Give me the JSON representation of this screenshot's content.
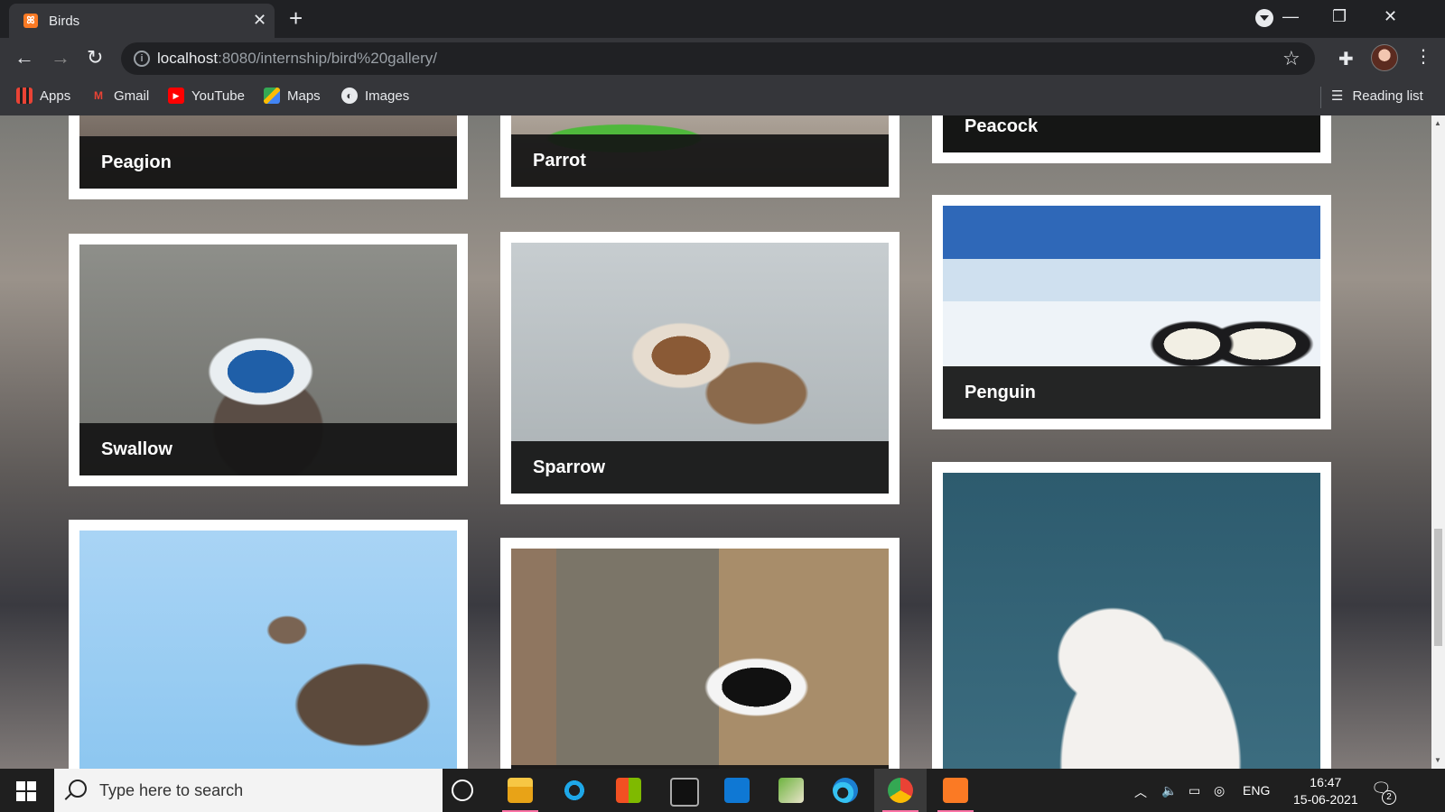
{
  "browser": {
    "tab_title": "Birds",
    "tab_favicon": "xampp-icon",
    "url_host": "localhost",
    "url_rest": ":8080/internship/bird%20gallery/",
    "bookmarks": [
      "Apps",
      "Gmail",
      "YouTube",
      "Maps",
      "Images"
    ],
    "reading_list": "Reading list"
  },
  "gallery": {
    "cards": [
      {
        "label": "Peagion"
      },
      {
        "label": "Parrot"
      },
      {
        "label": "Peacock"
      },
      {
        "label": "Swallow"
      },
      {
        "label": "Sparrow"
      },
      {
        "label": "Penguin"
      },
      {
        "label": ""
      },
      {
        "label": ""
      },
      {
        "label": ""
      }
    ]
  },
  "taskbar": {
    "search_placeholder": "Type here to search",
    "language": "ENG",
    "time": "16:47",
    "date": "15-06-2021",
    "notification_count": "2"
  },
  "colors": {
    "xampp_orange": "#fb7a24",
    "chrome_dark": "#202124",
    "chrome_toolbar": "#35363a"
  }
}
